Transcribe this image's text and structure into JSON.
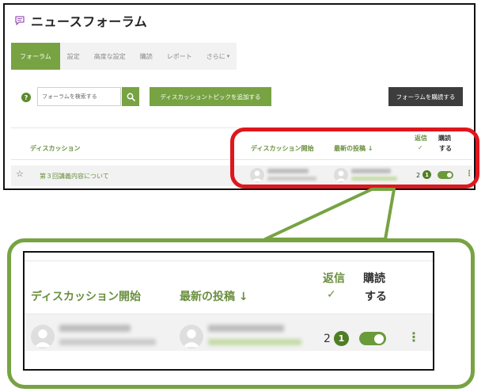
{
  "page_title": "ニュースフォーラム",
  "tabs": [
    {
      "label": "フォーラム",
      "active": true
    },
    {
      "label": "設定"
    },
    {
      "label": "高度な設定"
    },
    {
      "label": "購読"
    },
    {
      "label": "レポート"
    },
    {
      "label": "さらに",
      "has_dropdown": true
    }
  ],
  "search": {
    "placeholder": "フォーラムを検索する"
  },
  "buttons": {
    "add_topic": "ディスカッショントピックを追加する",
    "subscribe_forum": "フォーラムを購読する"
  },
  "table": {
    "headers": {
      "discussion": "ディスカッション",
      "started_by": "ディスカッション開始",
      "last_post": "最新の投稿 ↓",
      "replies": "返信",
      "subscribe_line1": "購読",
      "subscribe_line2": "する"
    },
    "check_mark": "✓",
    "rows": [
      {
        "title": "第３回講義内容について",
        "replies": "2",
        "unread": "1",
        "subscribed": true
      }
    ]
  },
  "zoom": {
    "headers": {
      "started_by": "ディスカッション開始",
      "last_post": "最新の投稿 ↓",
      "replies": "返信",
      "subscribe_line1": "購読",
      "subscribe_line2": "する"
    },
    "check_mark": "✓",
    "row": {
      "replies": "2",
      "unread": "1",
      "subscribed": true
    }
  },
  "colors": {
    "accent_green": "#77a342",
    "badge_green": "#4e7d25",
    "highlight_red": "#e0161d",
    "dark_button": "#3d3d3d"
  },
  "icons": [
    "forum-icon",
    "help-icon",
    "search-icon",
    "star-icon",
    "user-icon",
    "toggle-switch",
    "kebab-menu-icon",
    "chevron-down-icon"
  ]
}
